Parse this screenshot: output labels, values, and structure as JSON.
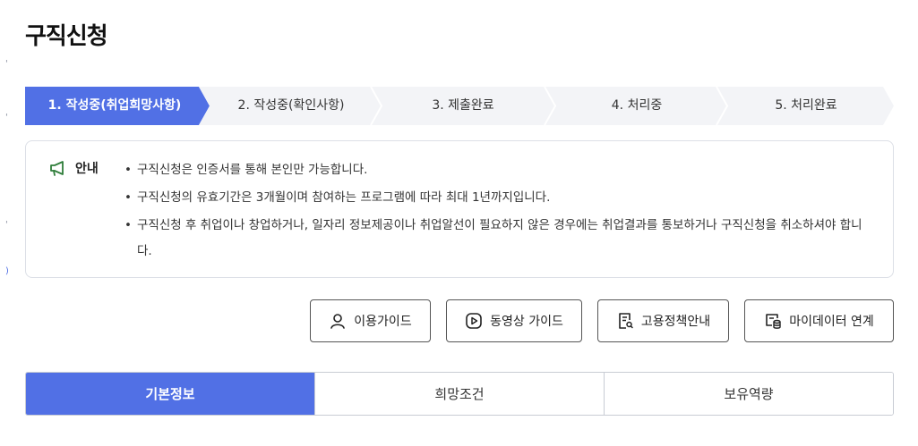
{
  "page": {
    "title": "구직신청"
  },
  "steps": [
    {
      "label": "1. 작성중(취업희망사항)",
      "active": true
    },
    {
      "label": "2. 작성중(확인사항)",
      "active": false
    },
    {
      "label": "3. 제출완료",
      "active": false
    },
    {
      "label": "4. 처리중",
      "active": false
    },
    {
      "label": "5. 처리완료",
      "active": false
    }
  ],
  "notice": {
    "label": "안내",
    "icon": "megaphone-icon",
    "items": [
      "구직신청은 인증서를 통해 본인만 가능합니다.",
      "구직신청의 유효기간은 3개월이며 참여하는 프로그램에 따라 최대 1년까지입니다.",
      "구직신청 후 취업이나 창업하거나, 일자리 정보제공이나 취업알선이 필요하지 않은 경우에는 취업결과를 통보하거나 구직신청을 취소하셔야 합니다."
    ]
  },
  "guide_buttons": [
    {
      "label": "이용가이드",
      "icon": "person-icon"
    },
    {
      "label": "동영상 가이드",
      "icon": "play-icon"
    },
    {
      "label": "고용정책안내",
      "icon": "document-search-icon"
    },
    {
      "label": "마이데이터 연계",
      "icon": "data-link-icon"
    }
  ],
  "tabs": [
    {
      "label": "기본정보",
      "active": true
    },
    {
      "label": "희망조건",
      "active": false
    },
    {
      "label": "보유역량",
      "active": false
    }
  ],
  "colors": {
    "accent": "#5170e5",
    "step_inactive": "#f3f4f7",
    "step_separator": "#ffffff",
    "notice_icon": "#2f7d3a"
  }
}
